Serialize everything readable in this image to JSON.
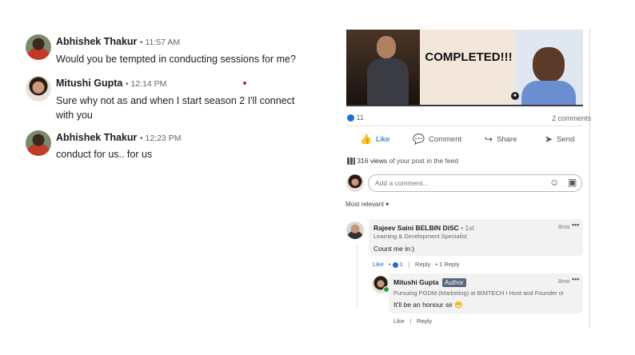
{
  "chat": {
    "messages": [
      {
        "sender": "Abhishek Thakur",
        "time": "• 11:57 AM",
        "text": "Would you be tempted in conducting sessions for me?"
      },
      {
        "sender": "Mitushi Gupta",
        "time": "• 12:14 PM",
        "text": "Sure why not as and when I start season 2 I'll connect with you"
      },
      {
        "sender": "Abhishek Thakur",
        "time": "• 12:23 PM",
        "text": "conduct for us.. for us"
      }
    ]
  },
  "post": {
    "media_caption": "COMPLETED!!!",
    "reactions_count": "11",
    "comments_count": "2 comments",
    "actions": {
      "like": "Like",
      "comment": "Comment",
      "share": "Share",
      "send": "Send"
    },
    "views_count": "316 views",
    "views_suffix": "of your post in the feed",
    "comment_placeholder": "Add a comment...",
    "sort_label": "Most relevant",
    "comments": [
      {
        "name": "Rajeev Saini BELBIN DiSC",
        "degree": "• 1st",
        "headline": "Learning & Development Specialist",
        "text": "Count me in:)",
        "age": "8mo",
        "like": "Like",
        "like_count": "1",
        "reply": "Reply",
        "reply_count": "1 Reply"
      }
    ],
    "reply": {
      "name": "Mitushi Gupta",
      "badge": "Author",
      "headline": "Pursuing PGDM (Marketing) at BIMTECH I Host and Founder of...",
      "text": "It'll be an honour sir",
      "emoji": "😁",
      "age": "8mo",
      "like": "Like",
      "reply": "Reply"
    }
  },
  "colors": {
    "link_blue": "#0a66c2",
    "author_badge": "#56687a",
    "online_green": "#2e9a3e"
  }
}
